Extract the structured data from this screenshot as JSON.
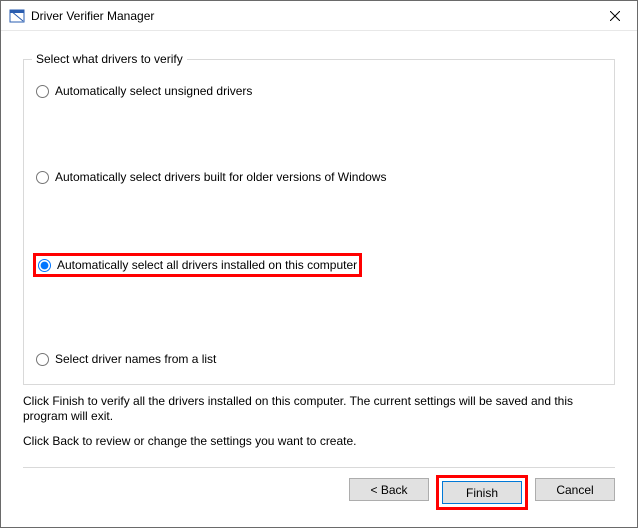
{
  "window": {
    "title": "Driver Verifier Manager"
  },
  "fieldset": {
    "legend": "Select what drivers to verify"
  },
  "options": {
    "opt_unsigned": "Automatically select unsigned drivers",
    "opt_older": "Automatically select drivers built for older versions of Windows",
    "opt_all": "Automatically select all drivers installed on this computer",
    "opt_list": "Select driver names from a list",
    "selected": "opt_all"
  },
  "instructions": {
    "line1": "Click Finish to verify all the drivers installed on this computer. The current settings will be saved and this program will exit.",
    "line2": "Click Back to review or change the settings you want to create."
  },
  "buttons": {
    "back": "< Back",
    "finish": "Finish",
    "cancel": "Cancel"
  }
}
